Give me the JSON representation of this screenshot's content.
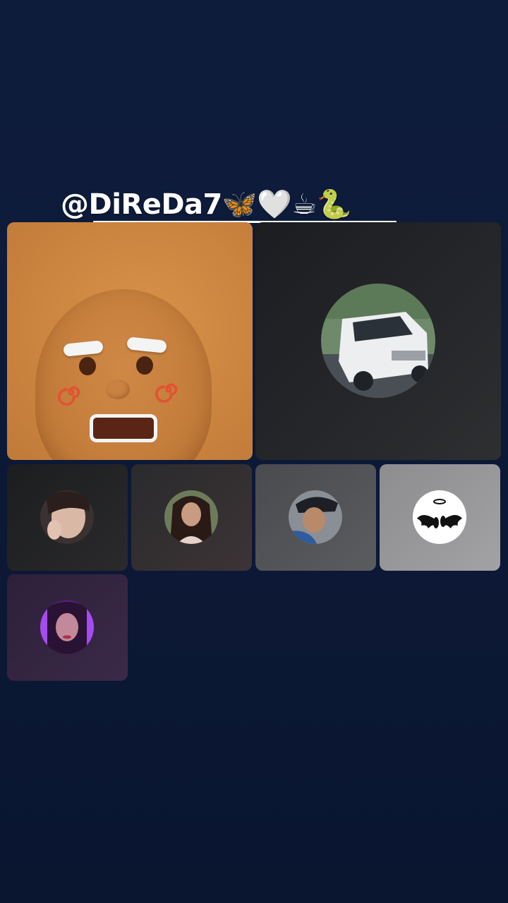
{
  "room": {
    "host_handle": "@DiReDa7🦋🤍☕🐍"
  },
  "participants": [
    {
      "role": "host",
      "avatar": "gingerbread-face"
    },
    {
      "role": "guest",
      "avatar": "white-van-photo"
    },
    {
      "role": "guest",
      "avatar": "woman-photo"
    },
    {
      "role": "guest",
      "avatar": "woman-long-hair-photo"
    },
    {
      "role": "guest",
      "avatar": "man-cap-photo"
    },
    {
      "role": "guest",
      "avatar": "angel-wings-footprints-icon"
    },
    {
      "role": "guest",
      "avatar": "purple-light-woman-photo"
    }
  ],
  "colors": {
    "background": "#0d1a38",
    "host_tile": "#cc8540",
    "text": "#ffffff"
  }
}
